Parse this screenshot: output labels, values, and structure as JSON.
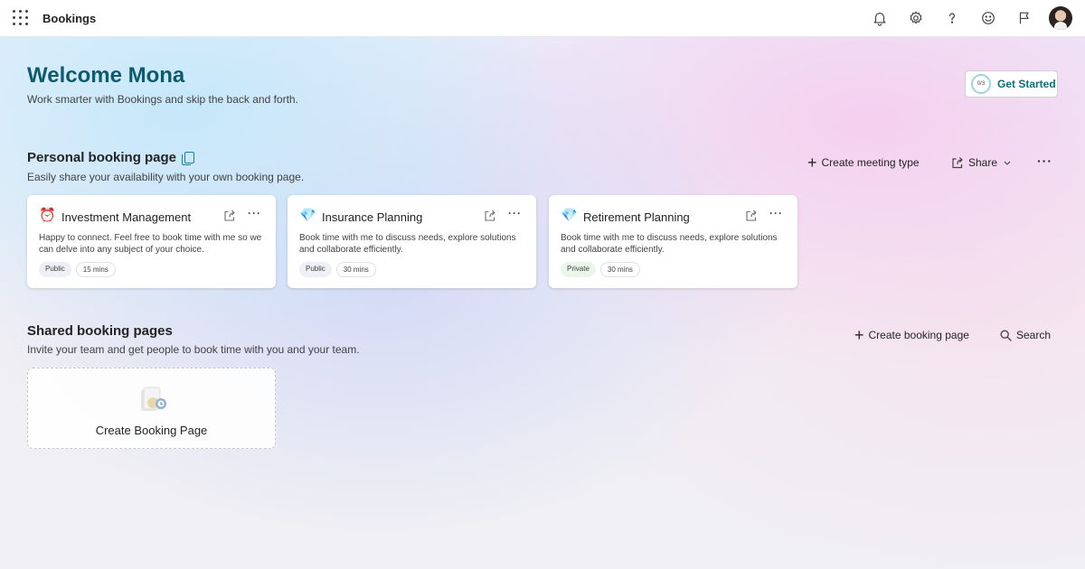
{
  "app": {
    "title": "Bookings"
  },
  "topbar": {
    "icons": [
      "waffle-icon",
      "bell-icon",
      "gear-icon",
      "help-icon",
      "smiley-icon",
      "flag-icon"
    ],
    "avatar": "user-avatar"
  },
  "welcome": {
    "title": "Welcome Mona",
    "subtitle": "Work smarter with Bookings and skip the back and forth.",
    "get_started": {
      "progress": "0/3",
      "label": "Get Started"
    }
  },
  "personal": {
    "title": "Personal booking page",
    "subtitle": "Easily share your availability with your own booking page.",
    "create_label": "Create meeting type",
    "share_label": "Share",
    "cards": [
      {
        "icon": "⏰",
        "title": "Investment Management",
        "description": "Happy to connect. Feel free to book time with me so we can delve into any subject of your choice.",
        "visibility": "Public",
        "duration": "15 mins"
      },
      {
        "icon": "💎",
        "title": "Insurance Planning",
        "description": "Book time with me to discuss needs, explore solutions and collaborate efficiently.",
        "visibility": "Public",
        "duration": "30 mins"
      },
      {
        "icon": "💎",
        "title": "Retirement Planning",
        "description": "Book time with me to discuss needs, explore solutions and collaborate efficiently.",
        "visibility": "Private",
        "duration": "30 mins"
      }
    ]
  },
  "shared": {
    "title": "Shared booking pages",
    "subtitle": "Invite your team and get people to book time with you and your team.",
    "create_label": "Create booking page",
    "search_label": "Search",
    "create_card_label": "Create Booking Page"
  },
  "colors": {
    "accent": "#0f5a6e",
    "link": "#1a7fb0"
  }
}
